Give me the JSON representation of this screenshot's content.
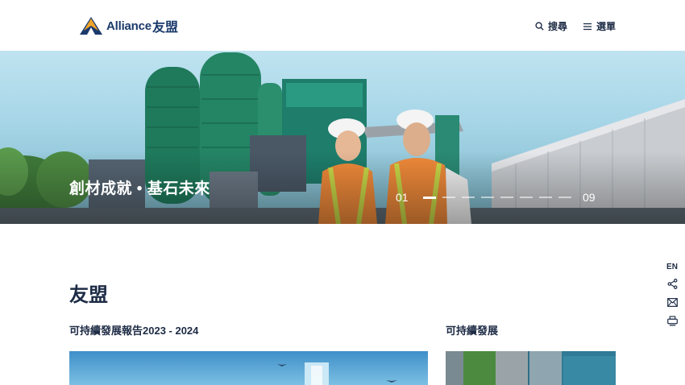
{
  "header": {
    "logo_text": "Alliance",
    "logo_cn": "友盟",
    "search_label": "搜尋",
    "menu_label": "選單"
  },
  "hero": {
    "title": "創材成就 • 基石未來",
    "pager": {
      "current": "01",
      "total": "09",
      "active_index": 1,
      "count": 9
    }
  },
  "side_tools": {
    "language": "EN",
    "icons": [
      "share-icon",
      "email-icon",
      "print-icon"
    ]
  },
  "main": {
    "title": "友盟",
    "cards": [
      {
        "title": "可持續發展報告2023 - 2024"
      },
      {
        "title": "可持續發展"
      }
    ]
  },
  "colors": {
    "brand_navy": "#1b3a6b",
    "brand_orange": "#f0a32a",
    "text": "#1d2b45"
  }
}
